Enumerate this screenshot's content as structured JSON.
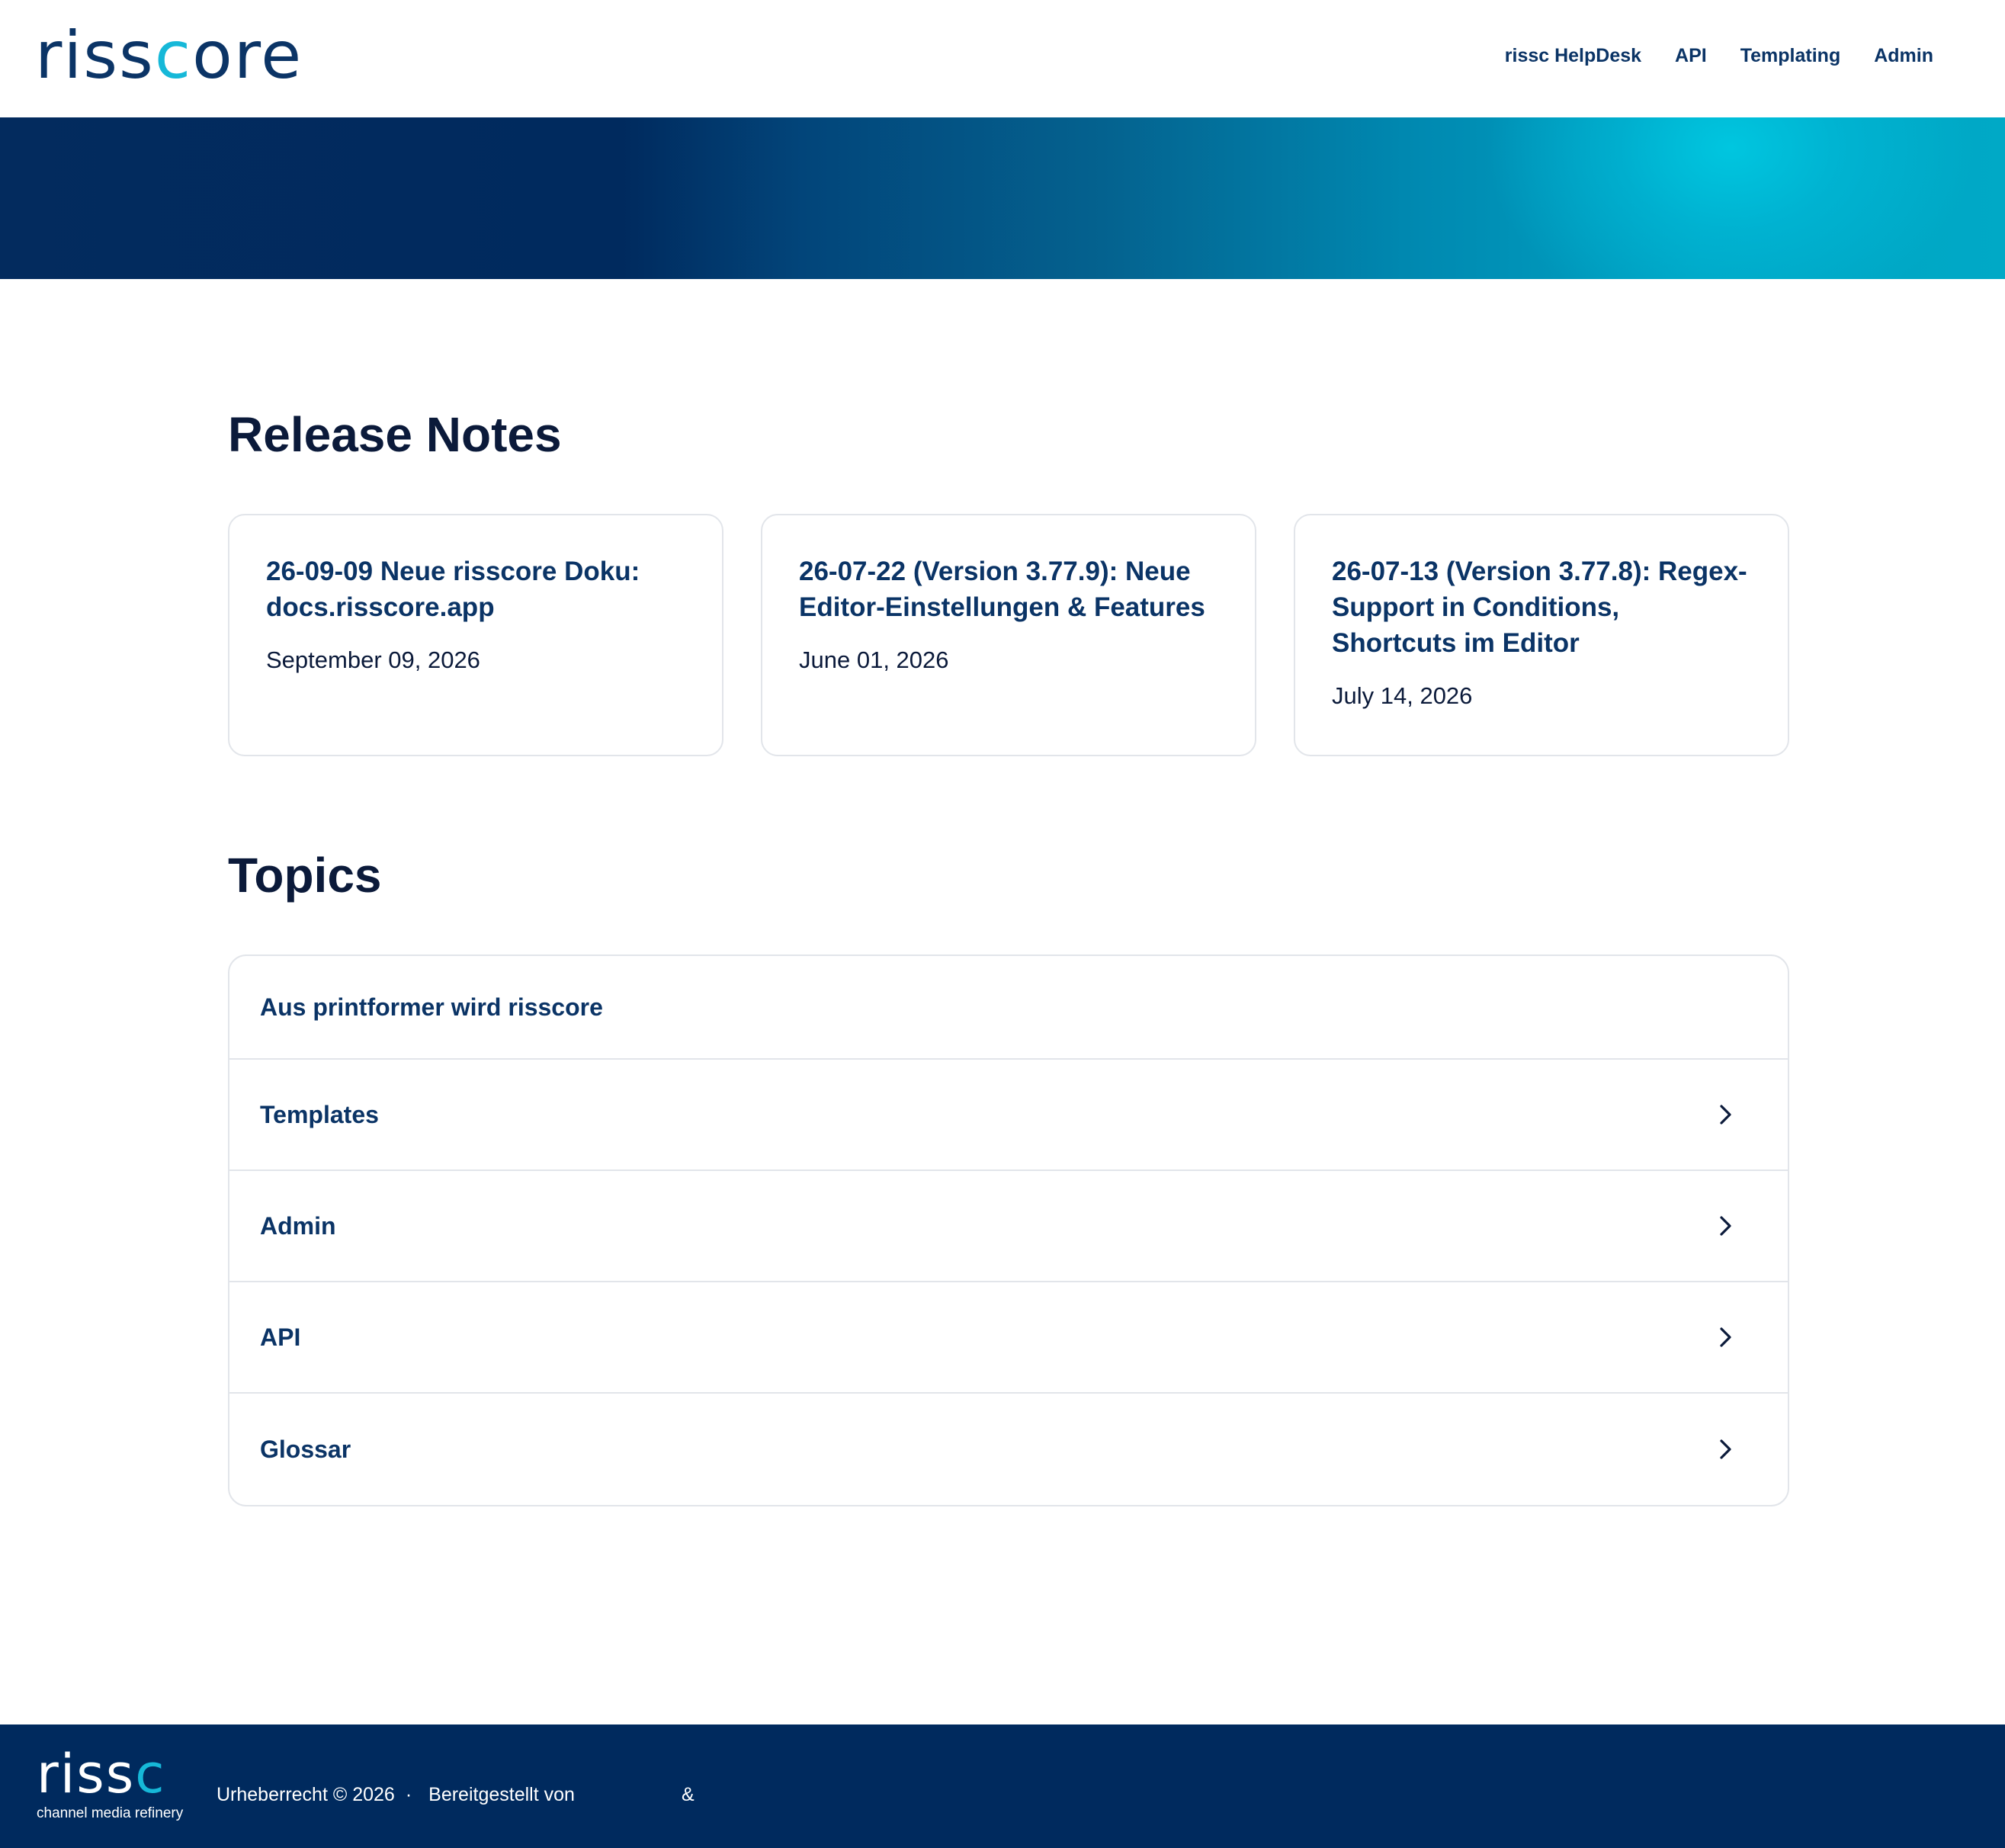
{
  "header": {
    "logo_main": "riss",
    "logo_accent": "c",
    "logo_tail": "ore",
    "nav": [
      "rissc HelpDesk",
      "API",
      "Templating",
      "Admin"
    ]
  },
  "colors": {
    "brand_dark": "#002a5e",
    "brand_accent": "#16b8d8",
    "text_link": "#0b3466"
  },
  "release_notes": {
    "title": "Release Notes",
    "items": [
      {
        "title": "26-09-09 Neue risscore Doku: docs.risscore.app",
        "date": "September 09, 2026"
      },
      {
        "title": "26-07-22 (Version 3.77.9): Neue Editor-Einstellungen & Features",
        "date": "June 01, 2026"
      },
      {
        "title": "26-07-13 (Version 3.77.8): Regex-Support in Conditions, Shortcuts im Editor",
        "date": "July 14, 2026"
      }
    ]
  },
  "topics": {
    "title": "Topics",
    "items": [
      {
        "label": "Aus printformer wird risscore"
      },
      {
        "label": "Templates",
        "icon": "chevron-right-icon"
      },
      {
        "label": "Admin",
        "icon": "chevron-right-icon"
      },
      {
        "label": "API",
        "icon": "chevron-right-icon"
      },
      {
        "label": "Glossar",
        "icon": "chevron-right-icon"
      }
    ]
  },
  "footer": {
    "logo_main": "riss",
    "logo_accent": "c",
    "tagline": "channel media refinery",
    "copyright": "Urheberrecht © 2026",
    "separator": "·",
    "provided_by": "Bereitgestellt von",
    "ampersand": "&"
  }
}
